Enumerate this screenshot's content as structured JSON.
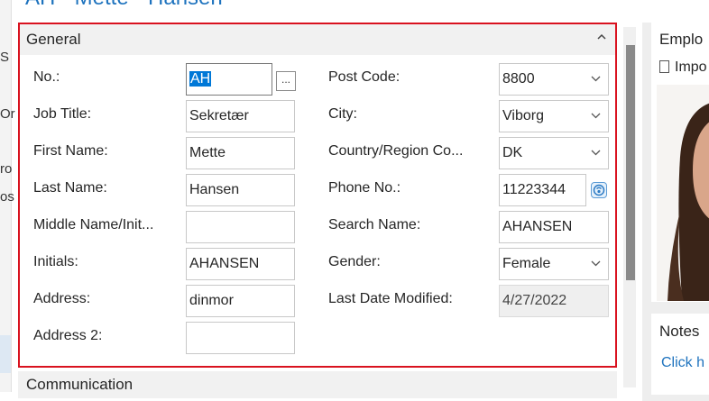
{
  "page_title": "AH · Mette · Hansen",
  "general": {
    "header": "General",
    "fields": {
      "no": {
        "label": "No.:",
        "value": "AH",
        "assist": "..."
      },
      "job_title": {
        "label": "Job Title:",
        "value": "Sekretær"
      },
      "first_name": {
        "label": "First Name:",
        "value": "Mette"
      },
      "last_name": {
        "label": "Last Name:",
        "value": "Hansen"
      },
      "middle_name": {
        "label": "Middle Name/Init...",
        "value": ""
      },
      "initials": {
        "label": "Initials:",
        "value": "AHANSEN"
      },
      "address": {
        "label": "Address:",
        "value": "dinmor"
      },
      "address2": {
        "label": "Address 2:",
        "value": ""
      },
      "post_code": {
        "label": "Post Code:",
        "value": "8800"
      },
      "city": {
        "label": "City:",
        "value": "Viborg"
      },
      "country": {
        "label": "Country/Region Co...",
        "value": "DK"
      },
      "phone": {
        "label": "Phone No.:",
        "value": "11223344"
      },
      "search_name": {
        "label": "Search Name:",
        "value": "AHANSEN"
      },
      "gender": {
        "label": "Gender:",
        "value": "Female"
      },
      "last_modified": {
        "label": "Last Date Modified:",
        "value": "4/27/2022"
      }
    }
  },
  "communication": {
    "header": "Communication"
  },
  "factbox": {
    "picture_title": "Emplo",
    "import_label": "Impo",
    "notes_title": "Notes",
    "notes_link": "Click h"
  },
  "left_fragments": [
    "S",
    "Or",
    "ro",
    "os"
  ],
  "icons": {
    "collapse": "chevron-up-icon",
    "dropdown": "chevron-down-icon",
    "phone": "phone-dial-icon",
    "document": "document-icon"
  },
  "colors": {
    "accent": "#1e73be",
    "focus_border": "#d9121f",
    "selection": "#0078d7"
  }
}
